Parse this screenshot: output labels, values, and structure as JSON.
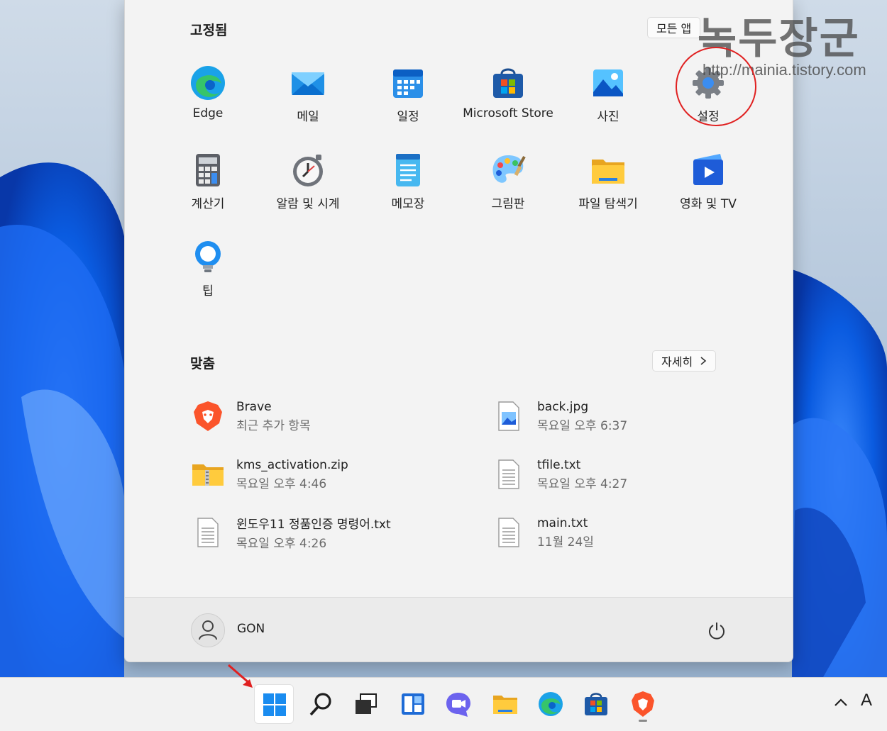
{
  "watermark": {
    "title": "녹두장군",
    "url": "http://mainia.tistory.com"
  },
  "pinned": {
    "title": "고정됨",
    "all_apps_label": "모든 앱",
    "apps": [
      {
        "label": "Edge",
        "icon": "edge-icon"
      },
      {
        "label": "메일",
        "icon": "mail-icon"
      },
      {
        "label": "일정",
        "icon": "calendar-icon"
      },
      {
        "label": "Microsoft Store",
        "icon": "store-icon"
      },
      {
        "label": "사진",
        "icon": "photos-icon"
      },
      {
        "label": "설정",
        "icon": "settings-gear-icon"
      },
      {
        "label": "계산기",
        "icon": "calculator-icon"
      },
      {
        "label": "알람 및 시계",
        "icon": "alarm-clock-icon"
      },
      {
        "label": "메모장",
        "icon": "notepad-icon"
      },
      {
        "label": "그림판",
        "icon": "paint-palette-icon"
      },
      {
        "label": "파일 탐색기",
        "icon": "file-explorer-icon"
      },
      {
        "label": "영화 및 TV",
        "icon": "movies-tv-icon"
      },
      {
        "label": "팁",
        "icon": "tips-bulb-icon"
      }
    ]
  },
  "recommended": {
    "title": "맞춤",
    "more_label": "자세히",
    "items": [
      {
        "name": "Brave",
        "sub": "최근 추가 항목",
        "icon": "brave-icon"
      },
      {
        "name": "back.jpg",
        "sub": "목요일 오후 6:37",
        "icon": "image-file-icon"
      },
      {
        "name": "kms_activation.zip",
        "sub": "목요일 오후 4:46",
        "icon": "zip-folder-icon"
      },
      {
        "name": "tfile.txt",
        "sub": "목요일 오후 4:27",
        "icon": "text-file-icon"
      },
      {
        "name": "윈도우11 정품인증 명령어.txt",
        "sub": "목요일 오후 4:26",
        "icon": "text-file-icon"
      },
      {
        "name": "main.txt",
        "sub": "11월 24일",
        "icon": "text-file-icon"
      }
    ]
  },
  "user": {
    "name": "GON"
  },
  "taskbar": {
    "items": [
      "start-icon",
      "search-icon",
      "task-view-icon",
      "widgets-icon",
      "chat-icon",
      "file-explorer-icon",
      "edge-icon",
      "store-icon",
      "brave-icon"
    ],
    "tray_ime": "A"
  },
  "colors": {
    "accent": "#0078d4",
    "highlight_circle": "#e02020"
  }
}
